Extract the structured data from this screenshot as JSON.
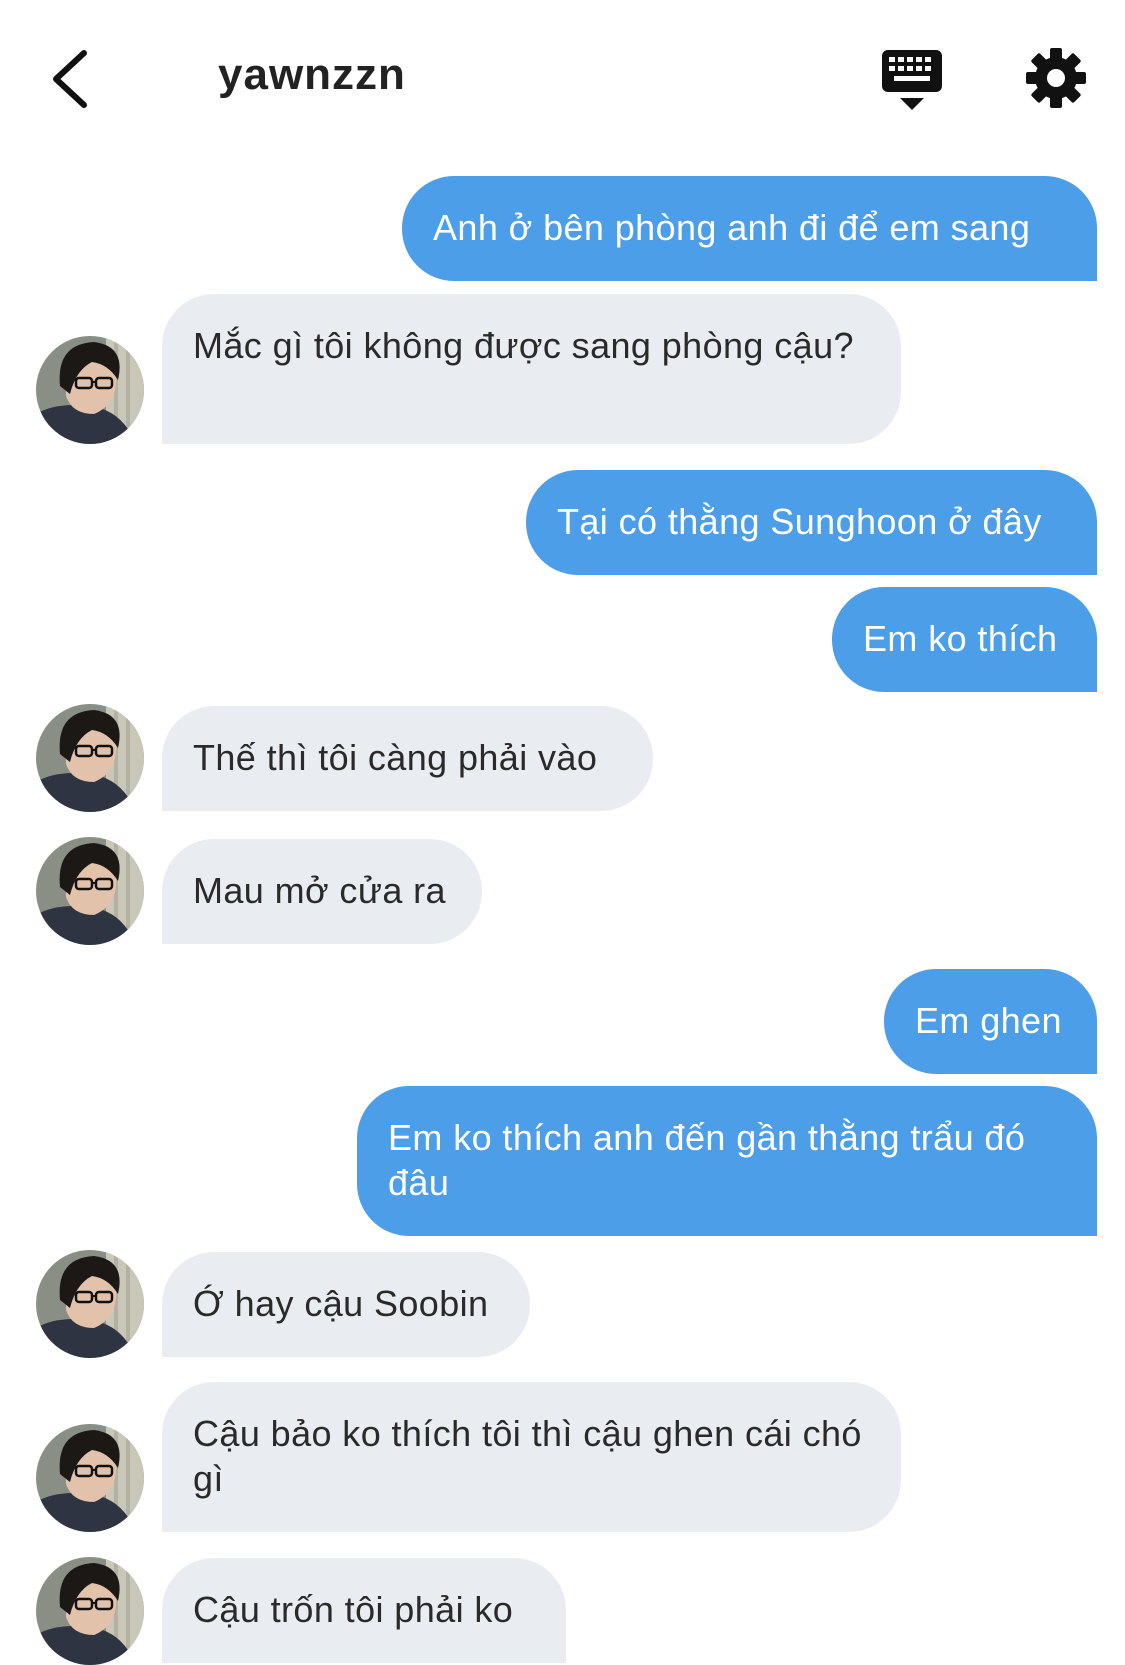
{
  "header": {
    "title": "yawnzzn",
    "back_icon": "chevron-left-icon",
    "keyboard_icon": "keyboard-icon",
    "settings_icon": "gear-icon"
  },
  "colors": {
    "outgoing_bubble": "#4d9ee9",
    "incoming_bubble": "#e9edf1"
  },
  "messages": [
    {
      "from": "me",
      "text": "Anh ở bên phòng anh đi để em sang"
    },
    {
      "from": "them",
      "text": "Mắc gì tôi không được sang phòng cậu?"
    },
    {
      "from": "me",
      "text": "Tại có thằng Sunghoon ở đây"
    },
    {
      "from": "me",
      "text": "Em ko thích"
    },
    {
      "from": "them",
      "text": "Thế thì tôi càng phải vào"
    },
    {
      "from": "them",
      "text": "Mau mở cửa ra"
    },
    {
      "from": "me",
      "text": "Em ghen"
    },
    {
      "from": "me",
      "text": "Em ko thích anh đến gần thằng trẩu đó đâu"
    },
    {
      "from": "them",
      "text": "Ớ hay cậu Soobin"
    },
    {
      "from": "them",
      "text": "Cậu bảo ko thích tôi thì cậu ghen cái chó gì"
    },
    {
      "from": "them",
      "text": "Cậu trốn tôi phải ko"
    }
  ]
}
